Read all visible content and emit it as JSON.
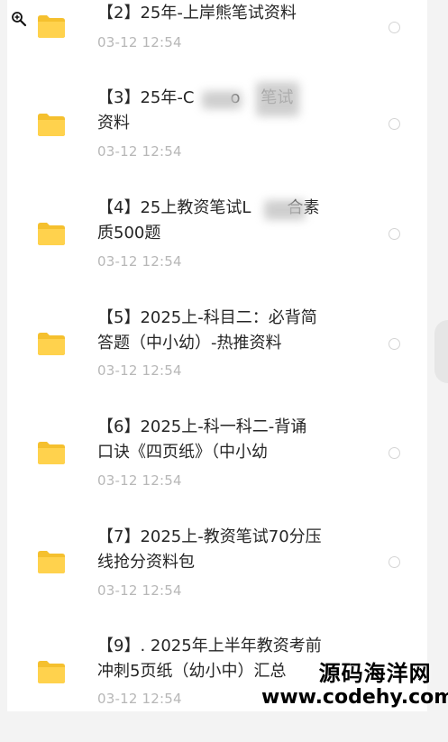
{
  "items": [
    {
      "title": "【2】25年-上岸熊笔试资料",
      "date": "03-12  12:54"
    },
    {
      "title": "【3】25年-C       o    笔试\n资料",
      "date": "03-12  12:54"
    },
    {
      "title": "【4】25上教资笔试L       合素\n质500题",
      "date": "03-12  12:54"
    },
    {
      "title": "【5】2025上-科目二：必背简\n答题（中小幼）-热推资料",
      "date": "03-12  12:54"
    },
    {
      "title": "【6】2025上-科一科二-背诵\n口诀《四页纸》（中小幼",
      "date": "03-12  12:54"
    },
    {
      "title": "【7】2025上-教资笔试70分压\n线抢分资料包",
      "date": "03-12  12:54"
    },
    {
      "title": "【9】. 2025年上半年教资考前\n冲刺5页纸（幼小中）汇总",
      "date": "03-12  12:54"
    }
  ],
  "watermark": {
    "name": "源码海洋网",
    "url": "www.codehy.com"
  },
  "colors": {
    "folder": "#ffd24d",
    "folder_tab": "#f5c02e",
    "title": "#262626",
    "date": "#b7b7b7"
  }
}
